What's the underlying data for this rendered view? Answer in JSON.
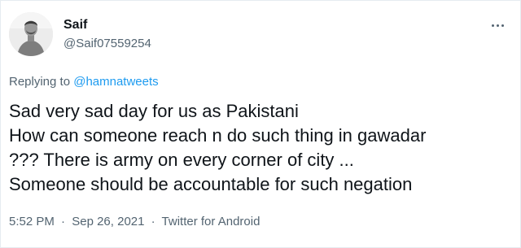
{
  "author": {
    "name": "Saif",
    "handle": "@Saif07559254",
    "avatar_icon": "user-avatar-photo"
  },
  "more_icon": "more-horizontal-icon",
  "reply": {
    "prefix": "Replying to",
    "mention": "@hamnatweets"
  },
  "tweet_lines": [
    "Sad very sad day for us as Pakistani",
    "How can someone reach n do such thing in gawadar",
    "??? There is army on every corner of city ...",
    "Someone should be accountable for such negation"
  ],
  "meta": {
    "time": "5:52 PM",
    "separator": "·",
    "date": "Sep 26, 2021",
    "source": "Twitter for Android"
  },
  "colors": {
    "text": "#0f1419",
    "secondary": "#536471",
    "link": "#1d9bf0"
  }
}
